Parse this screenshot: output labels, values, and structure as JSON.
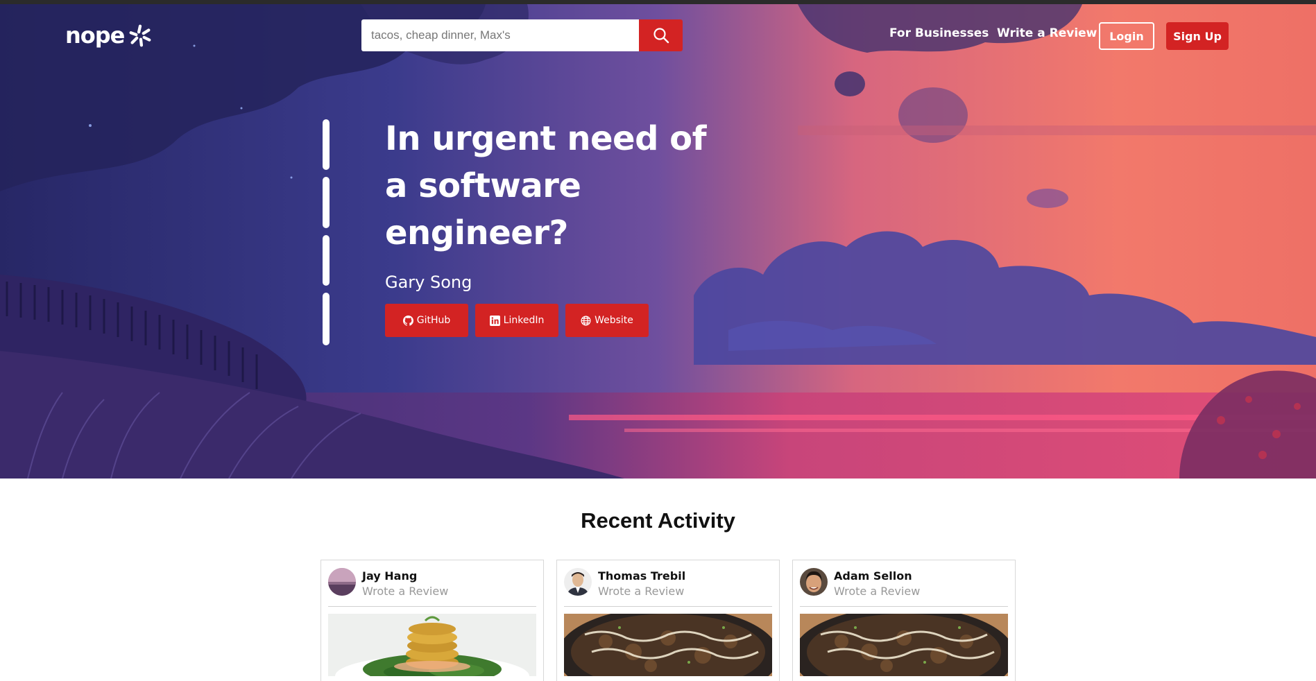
{
  "header": {
    "logo_text": "nope",
    "search": {
      "placeholder": "tacos, cheap dinner, Max's"
    },
    "nav": {
      "for_businesses": "For Businesses",
      "write_review": "Write a Review",
      "login": "Login",
      "signup": "Sign Up"
    }
  },
  "hero": {
    "headline": "In urgent need of a software engineer?",
    "author": "Gary Song",
    "links": [
      {
        "label": "GitHub",
        "icon": "github-icon"
      },
      {
        "label": "LinkedIn",
        "icon": "linkedin-icon"
      },
      {
        "label": "Website",
        "icon": "globe-icon"
      }
    ]
  },
  "recent_activity": {
    "title": "Recent Activity",
    "cards": [
      {
        "name": "Jay Hang",
        "action": "Wrote a Review",
        "photo": "fried green tomatoes dish"
      },
      {
        "name": "Thomas Trebil",
        "action": "Wrote a Review",
        "photo": "rice bowl dish"
      },
      {
        "name": "Adam Sellon",
        "action": "Wrote a Review",
        "photo": "rice bowl dish"
      }
    ]
  },
  "colors": {
    "brand_red": "#d32323",
    "white": "#ffffff"
  }
}
